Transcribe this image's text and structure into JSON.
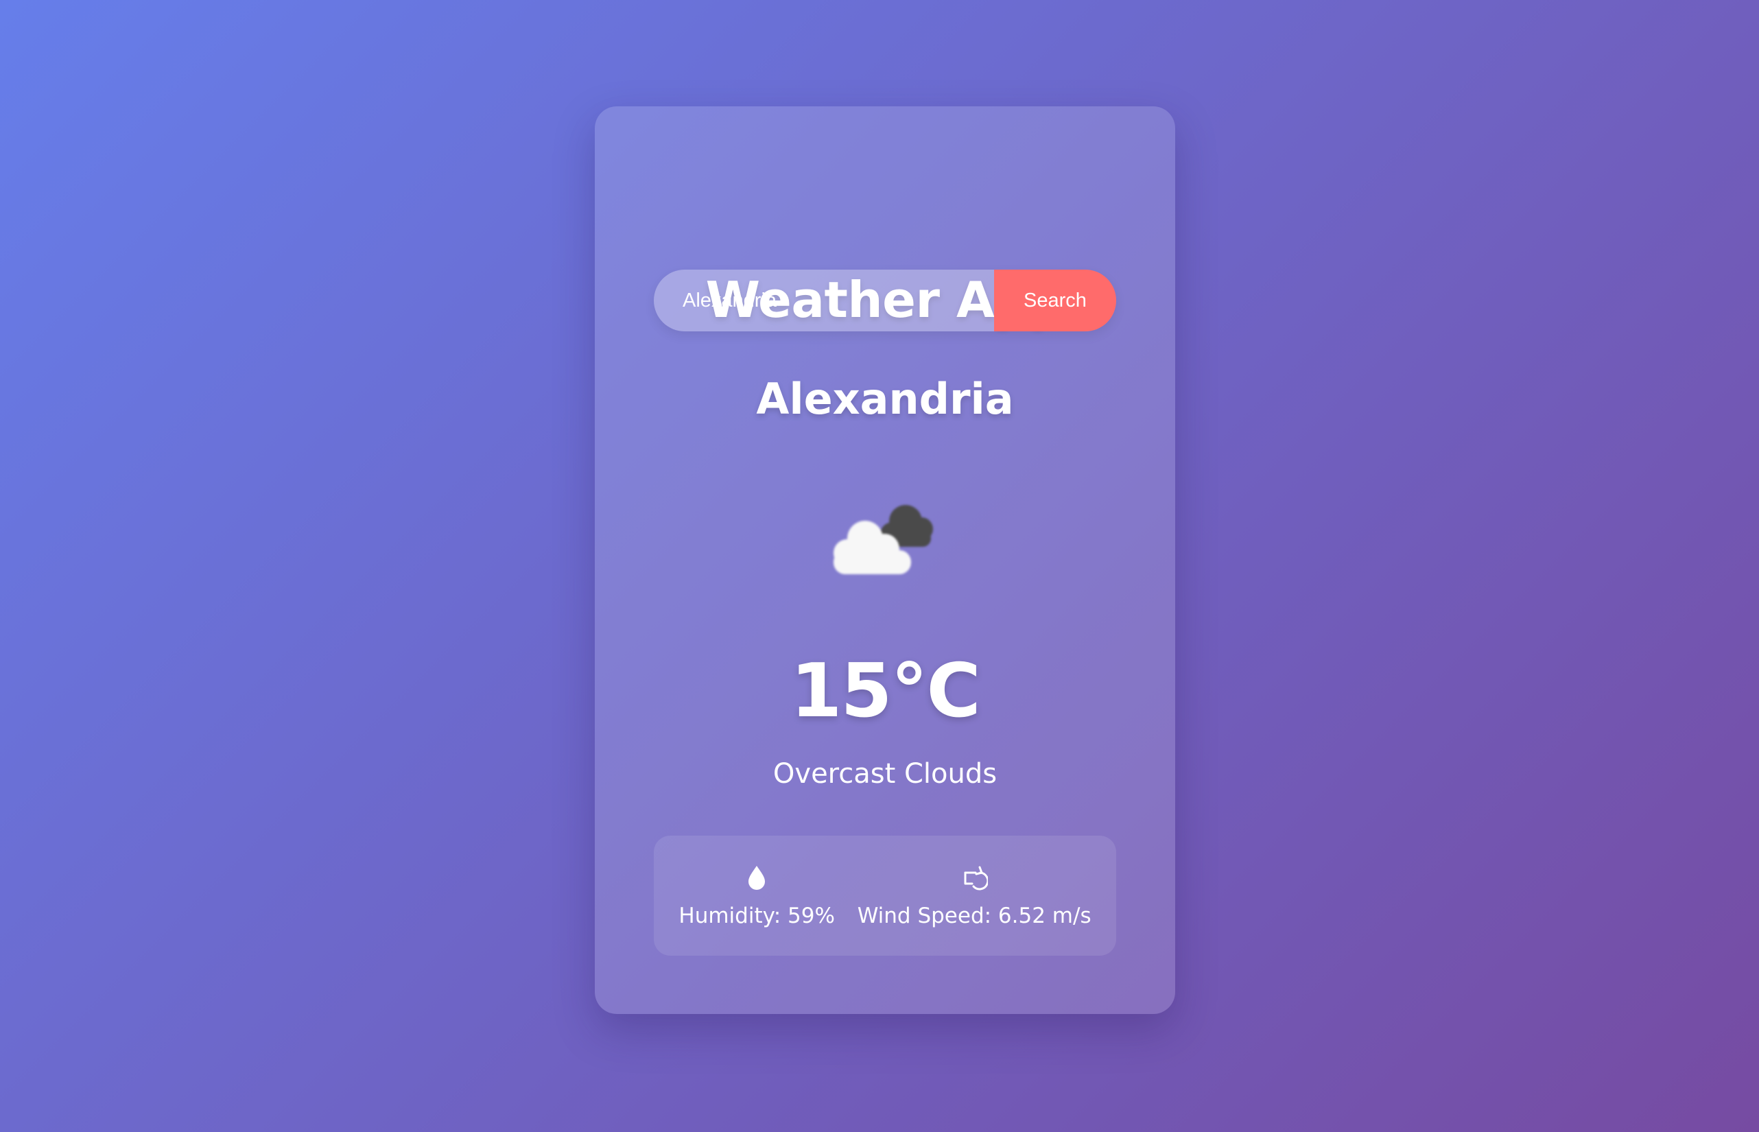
{
  "app": {
    "title": "Weather App"
  },
  "search": {
    "value": "Alexandria",
    "button_label": "Search"
  },
  "weather": {
    "city": "Alexandria",
    "temperature": "15°C",
    "description": "Overcast Clouds",
    "icon": "overcast-clouds-icon"
  },
  "details": {
    "humidity_label": "Humidity: 59%",
    "wind_label": "Wind Speed: 6.52 m/s",
    "humidity_icon": "droplet-icon",
    "wind_icon": "wind-rotate-icon"
  },
  "colors": {
    "background_start": "#667eea",
    "background_end": "#764ba2",
    "search_button": "#ff6b6b",
    "text": "#ffffff"
  }
}
